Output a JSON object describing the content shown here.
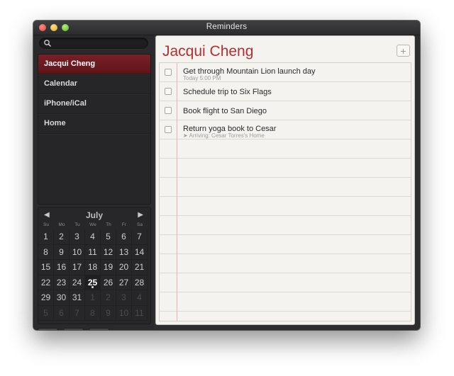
{
  "window": {
    "title": "Reminders"
  },
  "search": {
    "placeholder": "",
    "value": ""
  },
  "sidebar": {
    "lists": [
      {
        "label": "Jacqui Cheng",
        "selected": true
      },
      {
        "label": "Calendar",
        "selected": false
      },
      {
        "label": "iPhone/iCal",
        "selected": false
      },
      {
        "label": "Home",
        "selected": false
      }
    ]
  },
  "calendar": {
    "month": "July",
    "prev_icon": "triangle-left-icon",
    "next_icon": "triangle-right-icon",
    "weekdays": [
      "Su",
      "Mo",
      "Tu",
      "We",
      "Th",
      "Fr",
      "Sa"
    ],
    "today": "25",
    "weeks": [
      [
        "1",
        "2",
        "3",
        "4",
        "5",
        "6",
        "7"
      ],
      [
        "8",
        "9",
        "10",
        "11",
        "12",
        "13",
        "14"
      ],
      [
        "15",
        "16",
        "17",
        "18",
        "19",
        "20",
        "21"
      ],
      [
        "22",
        "23",
        "24",
        "25",
        "26",
        "27",
        "28"
      ],
      [
        "29",
        "30",
        "31",
        "1",
        "2",
        "3",
        "4"
      ],
      [
        "5",
        "6",
        "7",
        "8",
        "9",
        "10",
        "11"
      ]
    ]
  },
  "bottom_bar": {
    "buttons": [
      "show-hide-calendar-icon",
      "calendar-grid-icon",
      "plus-icon"
    ]
  },
  "main": {
    "title": "Jacqui Cheng",
    "add_label": "+",
    "reminders": [
      {
        "title": "Get through Mountain Lion launch day",
        "subtitle": "Today 5:00 PM"
      },
      {
        "title": "Schedule trip to Six Flags",
        "subtitle": ""
      },
      {
        "title": "Book flight to San Diego",
        "subtitle": ""
      },
      {
        "title": "Return yoga book to Cesar",
        "subtitle": "Arriving: Cesar Torres's Home",
        "subtitle_icon": "location-arrow-icon"
      }
    ]
  },
  "colors": {
    "accent": "#b3302f",
    "selection": "#6e1a22",
    "sidebar_bg": "#2a2a2c",
    "paper_bg": "#f4f3ef"
  }
}
